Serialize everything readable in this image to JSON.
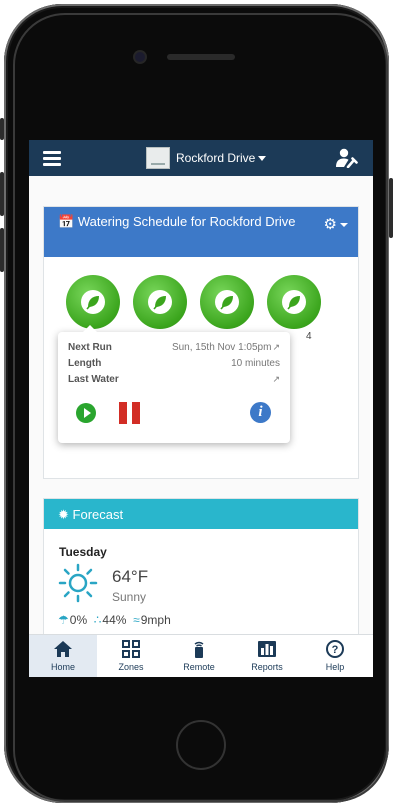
{
  "nav": {
    "title": "Rockford Drive"
  },
  "schedule": {
    "title": "Watering Schedule for Rockford Drive",
    "zones": [
      {
        "id": "zone-1"
      },
      {
        "id": "zone-2"
      },
      {
        "id": "zone-3"
      },
      {
        "id": "zone-4"
      }
    ],
    "visible_zone_number": "4",
    "popup": {
      "next_run_label": "Next Run",
      "next_run_value": "Sun, 15th Nov 1:05pm",
      "length_label": "Length",
      "length_value": "10 minutes",
      "last_water_label": "Last Water",
      "last_water_value": ""
    }
  },
  "forecast": {
    "title": "Forecast",
    "day": "Tuesday",
    "temperature": "64°F",
    "condition": "Sunny",
    "rain_chance": "0%",
    "humidity": "44%",
    "wind": "9mph"
  },
  "tabs": [
    {
      "label": "Home",
      "icon": "home-icon",
      "active": true
    },
    {
      "label": "Zones",
      "icon": "zones-grid-icon",
      "active": false
    },
    {
      "label": "Remote",
      "icon": "remote-icon",
      "active": false
    },
    {
      "label": "Reports",
      "icon": "bar-chart-icon",
      "active": false
    },
    {
      "label": "Help",
      "icon": "help-icon",
      "active": false
    }
  ],
  "colors": {
    "navbar": "#1c3a57",
    "schedule_header": "#3d79c8",
    "forecast_header": "#29b6cc",
    "zone_green": "#3ba51d",
    "play_green": "#2aa52e",
    "pause_red": "#d22d25"
  }
}
